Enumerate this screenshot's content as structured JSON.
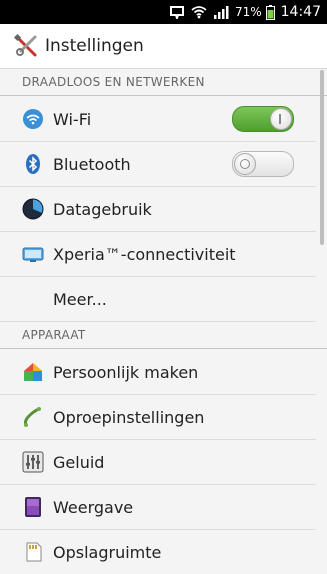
{
  "status_bar": {
    "battery_percent": "71%",
    "time": "14:47",
    "icons": [
      "notification-icon",
      "wifi-icon",
      "signal-icon",
      "battery-icon"
    ]
  },
  "action_bar": {
    "title": "Instellingen",
    "icon": "settings-tools-icon"
  },
  "sections": [
    {
      "header": "DRAADLOOS EN NETWERKEN",
      "items": [
        {
          "label": "Wi-Fi",
          "icon": "wifi-icon",
          "toggle": "on"
        },
        {
          "label": "Bluetooth",
          "icon": "bluetooth-icon",
          "toggle": "off"
        },
        {
          "label": "Datagebruik",
          "icon": "data-usage-icon"
        },
        {
          "label": "Xperia™-connectiviteit",
          "icon": "xperia-connectivity-icon"
        },
        {
          "label": "Meer..."
        }
      ]
    },
    {
      "header": "APPARAAT",
      "items": [
        {
          "label": "Persoonlijk maken",
          "icon": "personalize-icon"
        },
        {
          "label": "Oproepinstellingen",
          "icon": "call-settings-icon"
        },
        {
          "label": "Geluid",
          "icon": "sound-icon"
        },
        {
          "label": "Weergave",
          "icon": "display-icon"
        },
        {
          "label": "Opslagruimte",
          "icon": "storage-icon"
        }
      ]
    }
  ],
  "colors": {
    "toggle_on": "#5fb33c",
    "wifi_icon": "#3a8fd6",
    "bluetooth_icon": "#2a6fc0",
    "background": "#f4f4f4"
  }
}
